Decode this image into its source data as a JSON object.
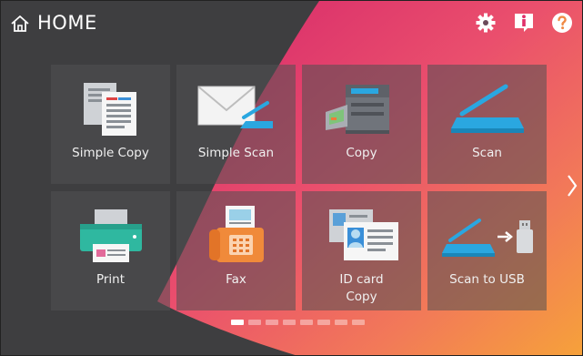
{
  "header": {
    "title": "HOME",
    "icons": [
      "home-icon",
      "gear-icon",
      "info-icon",
      "help-icon"
    ]
  },
  "tiles": [
    {
      "label": "Simple Copy",
      "icon": "simple-copy-icon"
    },
    {
      "label": "Simple Scan",
      "icon": "simple-scan-icon"
    },
    {
      "label": "Copy",
      "icon": "copier-icon"
    },
    {
      "label": "Scan",
      "icon": "scanner-icon"
    },
    {
      "label": "Print",
      "icon": "printer-icon"
    },
    {
      "label": "Fax",
      "icon": "fax-icon"
    },
    {
      "label": "ID card\nCopy",
      "icon": "id-card-icon"
    },
    {
      "label": "Scan to USB",
      "icon": "scan-usb-icon"
    }
  ],
  "pager": {
    "pages": 8,
    "current": 1
  },
  "colors": {
    "accent": "#2aa7e0",
    "background": "#3e3e40",
    "wave_start": "#e0306a",
    "wave_end": "#f7a23b"
  }
}
